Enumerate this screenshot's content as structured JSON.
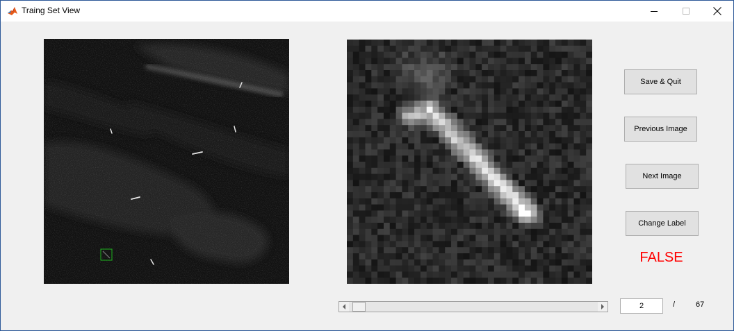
{
  "window": {
    "title": "Traing Set View"
  },
  "buttons": {
    "save_quit": "Save & Quit",
    "previous": "Previous Image",
    "next": "Next Image",
    "change_label": "Change Label"
  },
  "status": {
    "label_value": "FALSE",
    "label_color": "#ff0000"
  },
  "navigation": {
    "current_index": "2",
    "separator": "/",
    "total": "67",
    "slider_position": 0.015
  },
  "icons": {
    "app": "matlab-icon",
    "minimize": "minimize-icon",
    "maximize": "maximize-icon",
    "close": "close-icon"
  }
}
